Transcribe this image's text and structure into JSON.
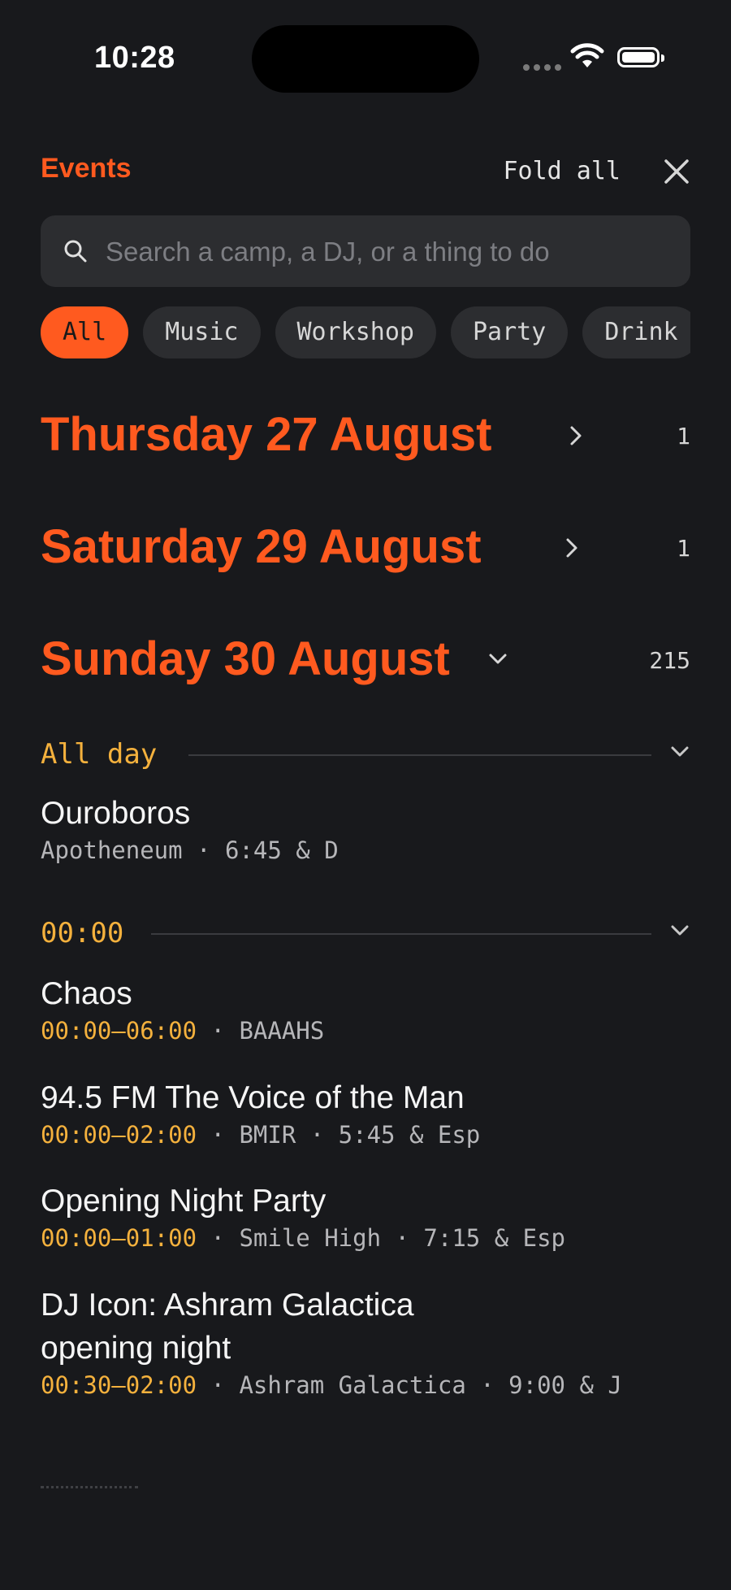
{
  "status_bar": {
    "time": "10:28"
  },
  "header": {
    "title": "Events",
    "fold_all_label": "Fold all"
  },
  "search": {
    "placeholder": "Search a camp, a DJ, or a thing to do"
  },
  "chips": [
    "All",
    "Music",
    "Workshop",
    "Party",
    "Drink"
  ],
  "days": [
    {
      "title": "Thursday 27 August",
      "count": "1",
      "expanded": false
    },
    {
      "title": "Saturday 29 August",
      "count": "1",
      "expanded": false
    },
    {
      "title": "Sunday 30 August",
      "count": "215",
      "expanded": true
    }
  ],
  "sections": [
    {
      "label": "All day",
      "events": [
        {
          "title": "Ouroboros",
          "meta": "Apotheneum · 6:45 & D"
        }
      ]
    },
    {
      "label": "00:00",
      "events": [
        {
          "title": "Chaos",
          "time": "00:00–06:00",
          "meta": "BAAAHS"
        },
        {
          "title": "94.5 FM The Voice of the Man",
          "time": "00:00–02:00",
          "meta": "BMIR · 5:45 & Esp"
        },
        {
          "title": "Opening Night Party",
          "time": "00:00–01:00",
          "meta": "Smile High · 7:15 & Esp"
        },
        {
          "title": "DJ Icon: Ashram Galactica opening night",
          "time": "00:30–02:00",
          "meta": "Ashram Galactica · 9:00 & J"
        }
      ]
    }
  ],
  "colors": {
    "accent": "#ff5a1f",
    "time": "#f4b13d",
    "background": "#18191c"
  }
}
